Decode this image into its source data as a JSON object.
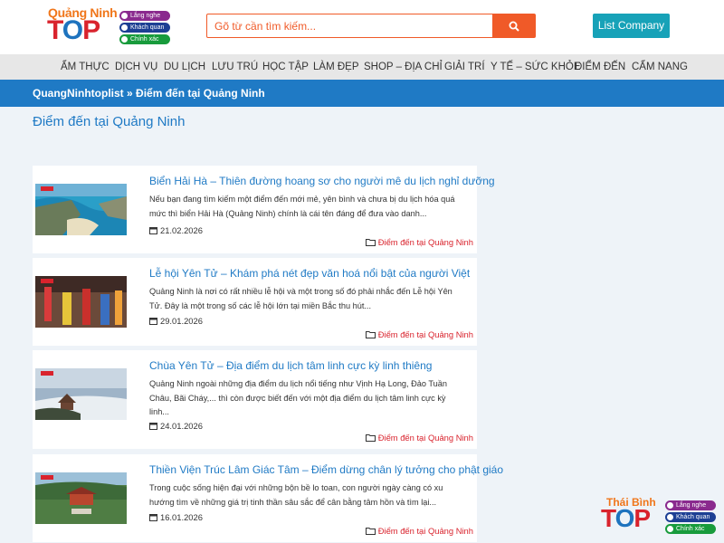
{
  "header": {
    "logo": {
      "top_text": "Quảng Ninh",
      "big_text": "TOP",
      "pills": [
        "Lắng nghe",
        "Khách quan",
        "Chính xác"
      ]
    },
    "search": {
      "placeholder": "Gõ từ cần tìm kiếm..."
    },
    "list_company_label": "List Company"
  },
  "nav": {
    "items": [
      "ẨM THỰC",
      "DỊCH VỤ",
      "DU LỊCH",
      "LƯU TRÚ",
      "HỌC TẬP",
      "LÀM ĐẸP",
      "SHOP – ĐỊA CHỈ",
      "GIẢI TRÍ",
      "Y TẾ – SỨC KHỎE",
      "ĐIỂM ĐẾN",
      "CẨM NANG"
    ]
  },
  "breadcrumb": {
    "home": "QuangNinhtoplist",
    "separator": "»",
    "current": "Điểm đến tại Quảng Ninh"
  },
  "page_title": "Điểm đến tại Quảng Ninh",
  "articles": [
    {
      "title": "Biển Hải Hà – Thiên đường hoang sơ cho người mê du lịch nghỉ dưỡng",
      "excerpt": "Nếu bạn đang tìm kiếm một điểm đến mới mẻ, yên bình và chưa bị du lịch hóa quá mức thì biển Hải Hà (Quảng Ninh) chính là cái tên đáng để đưa vào danh...",
      "date": "21.02.2026",
      "category": "Điểm đến tại Quảng Ninh"
    },
    {
      "title": "Lễ hội Yên Tử – Khám phá nét đẹp văn hoá nổi bật của người Việt",
      "excerpt": "Quảng Ninh là nơi có rất nhiều lễ hội và một trong số đó phải nhắc đến Lễ hội Yên Tử. Đây là một trong số các lễ hội lớn tại miền Bắc thu hút...",
      "date": "29.01.2026",
      "category": "Điểm đến tại Quảng Ninh"
    },
    {
      "title": "Chùa Yên Tử – Địa điểm du lịch tâm linh cực kỳ linh thiêng",
      "excerpt": "Quảng Ninh ngoài những địa điểm du lịch nổi tiếng như Vịnh Hạ Long, Đảo Tuần Châu, Bãi Cháy,... thì còn được biết đến với một địa điểm du lịch tâm linh cực kỳ linh...",
      "date": "24.01.2026",
      "category": "Điểm đến tại Quảng Ninh"
    },
    {
      "title": "Thiền Viện Trúc Lâm Giác Tâm – Điểm dừng chân lý tưởng cho phật giáo",
      "excerpt": "Trong cuộc sống hiện đại với những bộn bề lo toan, con người ngày càng có xu hướng tìm về những giá trị tinh thần sâu sắc để cân bằng tâm hồn và tìm lại...",
      "date": "16.01.2026",
      "category": "Điểm đến tại Quảng Ninh"
    }
  ],
  "corner_logo": {
    "top_text": "Thái Bình",
    "big_text": "TOP",
    "pills": [
      "Lắng nghe",
      "Khách quan",
      "Chính xác"
    ]
  },
  "colors": {
    "primary_blue": "#1f7ac5",
    "search_orange": "#f05a28",
    "list_company_teal": "#17a2b8",
    "category_red": "#d9232d",
    "nav_bg": "#e7e7e7"
  },
  "icons": {
    "search": "search-icon",
    "date": "calendar-icon",
    "category": "folder-icon"
  }
}
